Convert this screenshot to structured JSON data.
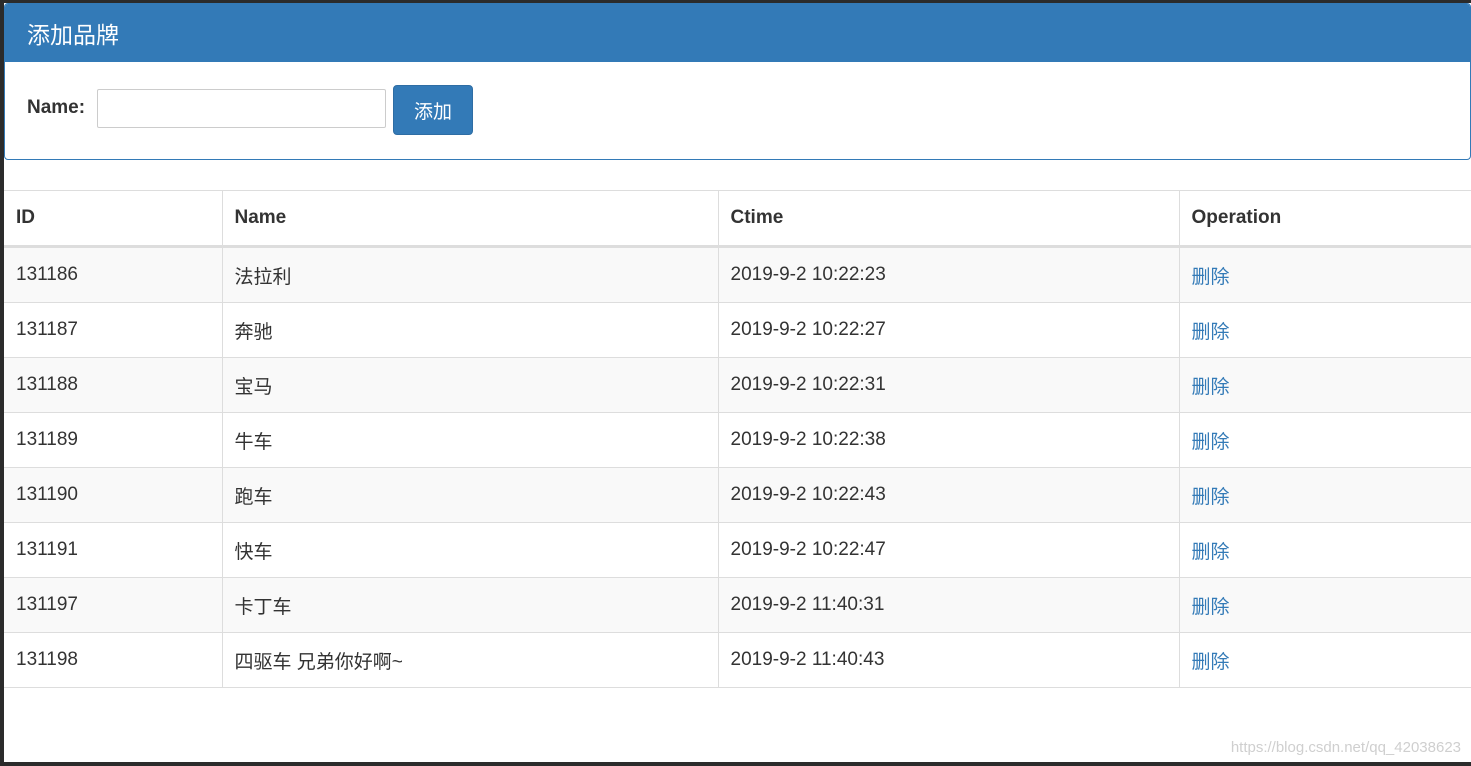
{
  "panel": {
    "title": "添加品牌",
    "name_label": "Name:",
    "name_value": "",
    "add_label": "添加"
  },
  "table": {
    "headers": [
      "ID",
      "Name",
      "Ctime",
      "Operation"
    ],
    "rows": [
      {
        "id": "131186",
        "name": "法拉利",
        "ctime": "2019-9-2 10:22:23",
        "op": "删除"
      },
      {
        "id": "131187",
        "name": "奔驰",
        "ctime": "2019-9-2 10:22:27",
        "op": "删除"
      },
      {
        "id": "131188",
        "name": "宝马",
        "ctime": "2019-9-2 10:22:31",
        "op": "删除"
      },
      {
        "id": "131189",
        "name": "牛车",
        "ctime": "2019-9-2 10:22:38",
        "op": "删除"
      },
      {
        "id": "131190",
        "name": "跑车",
        "ctime": "2019-9-2 10:22:43",
        "op": "删除"
      },
      {
        "id": "131191",
        "name": "快车",
        "ctime": "2019-9-2 10:22:47",
        "op": "删除"
      },
      {
        "id": "131197",
        "name": "卡丁车",
        "ctime": "2019-9-2 11:40:31",
        "op": "删除"
      },
      {
        "id": "131198",
        "name": "四驱车 兄弟你好啊~",
        "ctime": "2019-9-2 11:40:43",
        "op": "删除"
      }
    ]
  },
  "watermark": "https://blog.csdn.net/qq_42038623",
  "colors": {
    "primary": "#337ab7",
    "stripe": "#f9f9f9",
    "border": "#dddddd"
  }
}
